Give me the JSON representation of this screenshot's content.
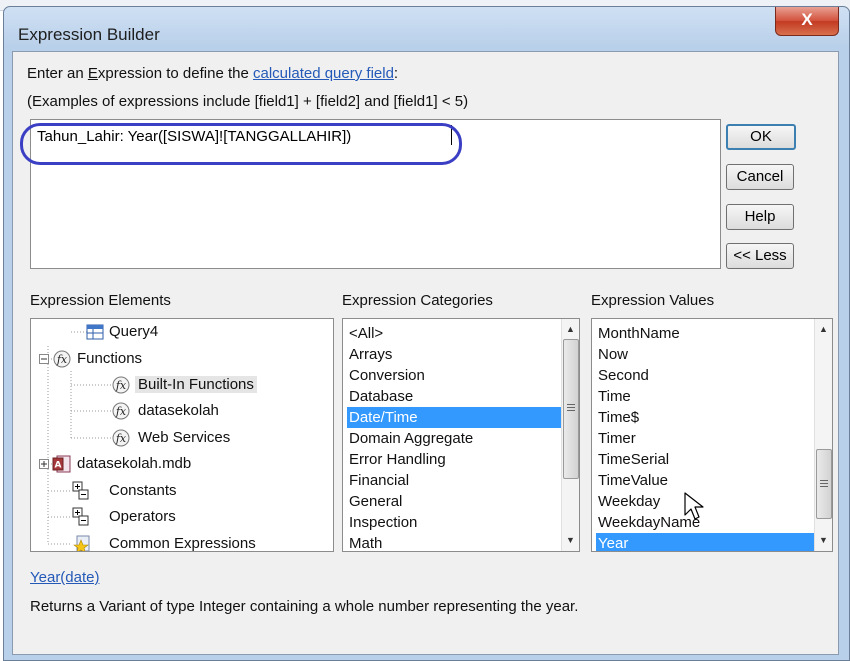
{
  "window": {
    "title": "Expression Builder",
    "close_glyph": "X"
  },
  "instructions": {
    "line1_pre": "Enter an ",
    "line1_acc": "E",
    "line1_mid": "xpression to define the ",
    "line1_link": "calculated query field",
    "line1_end": ":",
    "line2": "(Examples of expressions include [field1] + [field2] and [field1] < 5)"
  },
  "expression": {
    "value": "Tahun_Lahir: Year([SISWA]![TANGGALLAHIR])"
  },
  "buttons": {
    "ok": "OK",
    "cancel": "Cancel",
    "help": "Help",
    "less": "<< Less"
  },
  "elements": {
    "header": "Expression Elements",
    "items": [
      "Query4",
      "Functions",
      "Built-In Functions",
      "datasekolah",
      "Web Services",
      "datasekolah.mdb",
      "Constants",
      "Operators",
      "Common Expressions"
    ]
  },
  "categories": {
    "header": "Expression Categories",
    "items": [
      "<All>",
      "Arrays",
      "Conversion",
      "Database",
      "Date/Time",
      "Domain Aggregate",
      "Error Handling",
      "Financial",
      "General",
      "Inspection",
      "Math"
    ],
    "selected": "Date/Time"
  },
  "values": {
    "header": "Expression Values",
    "items": [
      "MonthName",
      "Now",
      "Second",
      "Time",
      "Time$",
      "Timer",
      "TimeSerial",
      "TimeValue",
      "Weekday",
      "WeekdayName",
      "Year"
    ],
    "selected": "Year"
  },
  "footer": {
    "syntax_link": "Year(date)",
    "description": "Returns a Variant of type Integer containing a whole number representing the year."
  },
  "colors": {
    "selection": "#3399ff",
    "link": "#2459b8",
    "highlight_ellipse": "#3b3fc4"
  }
}
